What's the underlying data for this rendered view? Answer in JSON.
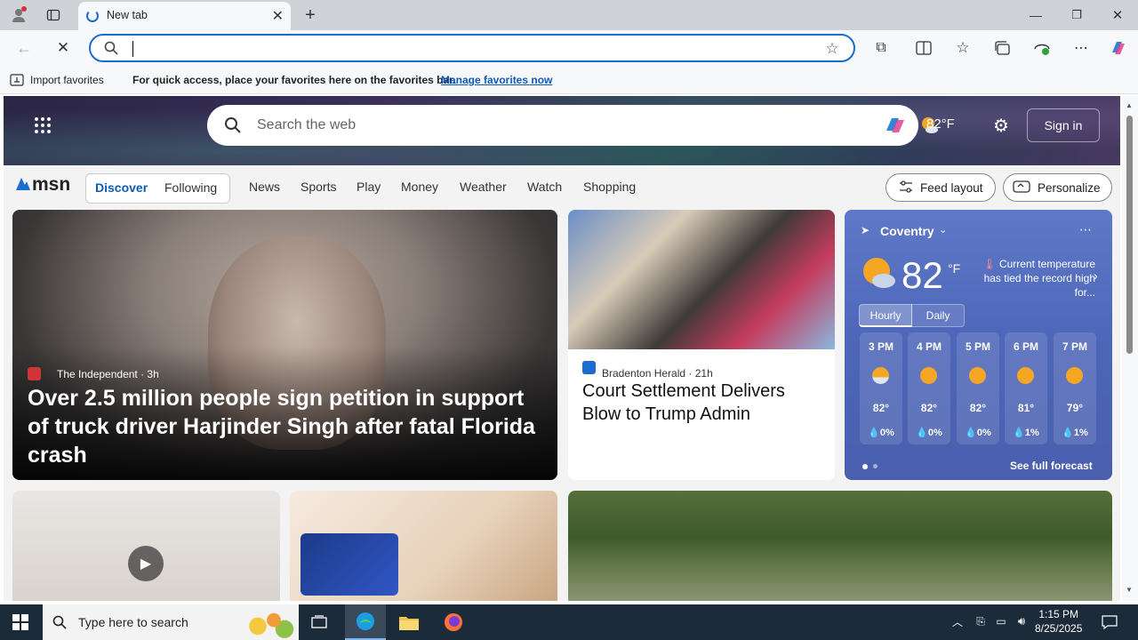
{
  "browser": {
    "tab_title": "New tab",
    "favorites_bar": {
      "import_label": "Import favorites",
      "hint": "For quick access, place your favorites here on the favorites bar.",
      "manage_link": "Manage favorites now"
    }
  },
  "msn": {
    "search_placeholder": "Search the web",
    "header_temp": "82°F",
    "sign_in": "Sign in",
    "logo": "msn",
    "nav": {
      "discover": "Discover",
      "following": "Following",
      "items": [
        "News",
        "Sports",
        "Play",
        "Money",
        "Weather",
        "Watch",
        "Shopping"
      ]
    },
    "feed_layout": "Feed layout",
    "personalize": "Personalize"
  },
  "lead_story": {
    "source": "The Independent",
    "age": "3h",
    "headline": "Over 2.5 million people sign petition in support of truck driver Harjinder Singh after fatal Florida crash"
  },
  "second_story": {
    "source": "Bradenton Herald",
    "age": "21h",
    "headline": "Court Settlement Delivers Blow to Trump Admin"
  },
  "weather": {
    "city": "Coventry",
    "temp": "82",
    "unit": "°F",
    "alert": "Current temperature has tied the record high for...",
    "tabs": [
      "Hourly",
      "Daily"
    ],
    "hours": [
      {
        "time": "3 PM",
        "temp": "82°",
        "precip": "0%"
      },
      {
        "time": "4 PM",
        "temp": "82°",
        "precip": "0%"
      },
      {
        "time": "5 PM",
        "temp": "82°",
        "precip": "0%"
      },
      {
        "time": "6 PM",
        "temp": "81°",
        "precip": "1%"
      },
      {
        "time": "7 PM",
        "temp": "79°",
        "precip": "1%"
      }
    ],
    "full_forecast": "See full forecast"
  },
  "taskbar": {
    "search_placeholder": "Type here to search",
    "time": "1:15 PM",
    "date": "8/25/2025"
  },
  "colors": {
    "accent": "#1b6ccf",
    "msn_discover": "#0f5ab5",
    "taskbar_bg": "#1c2b3a"
  }
}
